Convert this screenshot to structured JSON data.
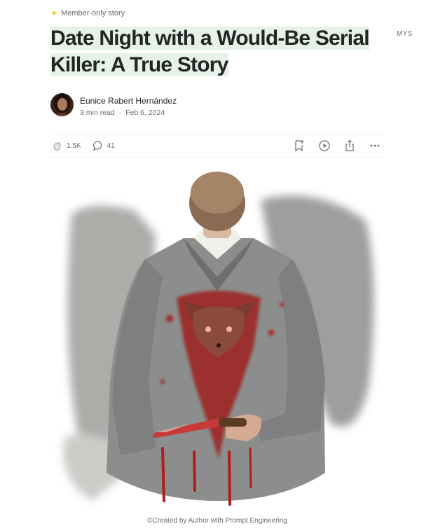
{
  "header": {
    "member_label": "Member-only story",
    "user_initials": "MYS"
  },
  "article": {
    "title_line1": "Date Night with a Would-Be Serial",
    "title_line2": "Killer: A True Story",
    "author": "Eunice Rabert Hernández",
    "read_time": "3 min read",
    "separator": "·",
    "date": "Feb 6, 2024",
    "claps": "1.5K",
    "responses": "41",
    "caption": "©Created by Author with Prompt Engineering"
  },
  "icons": {
    "member": "sparkle-star-icon",
    "clap": "clap-icon",
    "response": "speech-bubble-icon",
    "save": "bookmark-add-icon",
    "listen": "play-circle-icon",
    "share": "share-icon",
    "more": "more-dots-icon"
  },
  "colors": {
    "accent_star": "#ffc017",
    "title_highlight": "#e6f2e8",
    "text": "#242424",
    "muted": "#6b6b6b"
  }
}
